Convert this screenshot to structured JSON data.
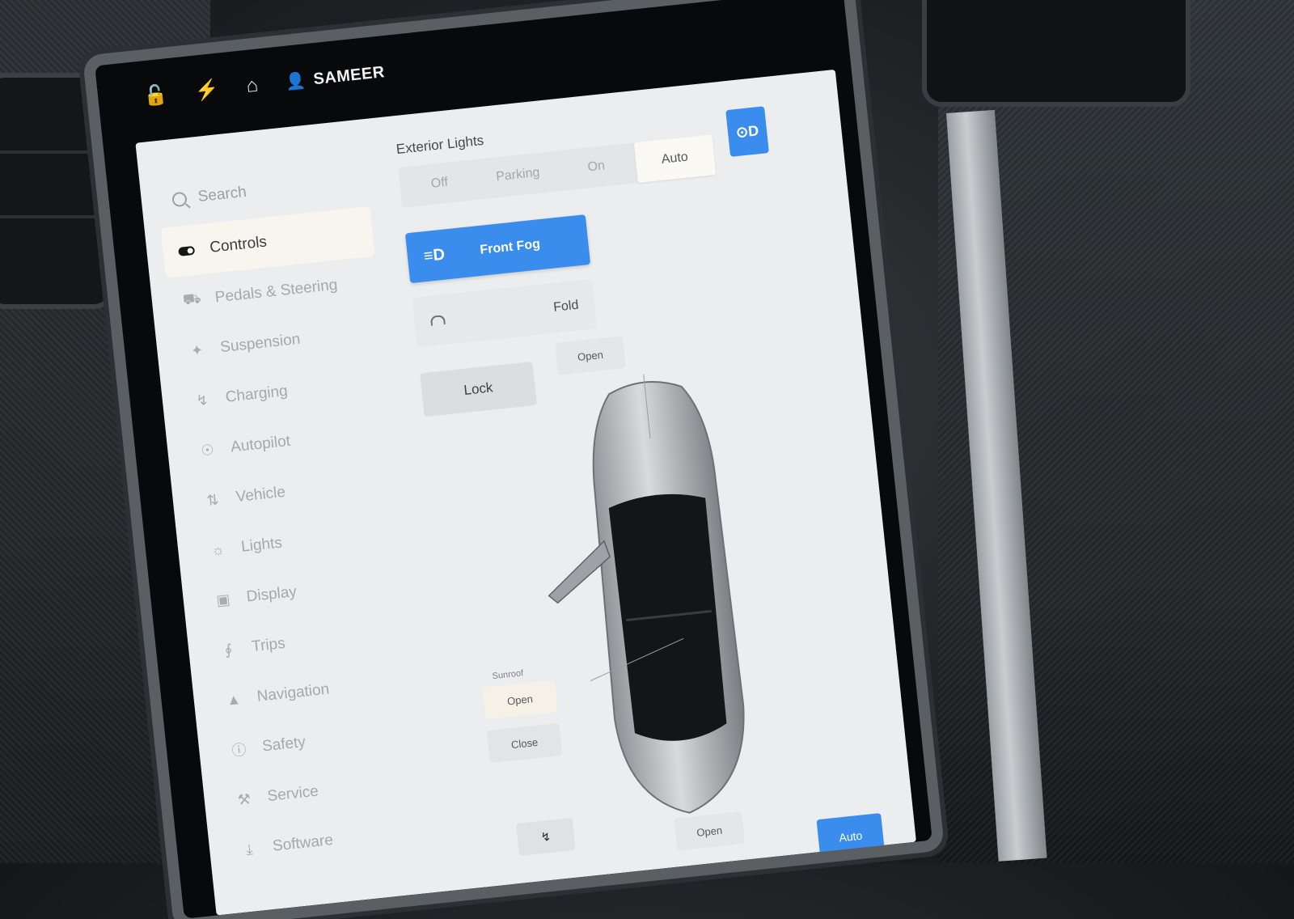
{
  "status_bar": {
    "icons": [
      "lock-open-icon",
      "bolt-icon",
      "home-icon",
      "user-icon"
    ],
    "user_name": "SAMEER"
  },
  "sidebar": {
    "search_placeholder": "Search",
    "items": [
      {
        "label": "Controls",
        "icon": "toggle-icon",
        "active": true
      },
      {
        "label": "Pedals & Steering",
        "icon": "car-icon"
      },
      {
        "label": "Suspension",
        "icon": "wrench-icon"
      },
      {
        "label": "Charging",
        "icon": "bolt-icon"
      },
      {
        "label": "Autopilot",
        "icon": "steering-wheel-icon"
      },
      {
        "label": "Vehicle",
        "icon": "sliders-icon"
      },
      {
        "label": "Lights",
        "icon": "sun-icon"
      },
      {
        "label": "Display",
        "icon": "display-icon"
      },
      {
        "label": "Trips",
        "icon": "trips-icon"
      },
      {
        "label": "Navigation",
        "icon": "navigation-arrow-icon"
      },
      {
        "label": "Safety",
        "icon": "info-circle-icon"
      },
      {
        "label": "Service",
        "icon": "wrench-icon"
      },
      {
        "label": "Software",
        "icon": "download-icon"
      }
    ]
  },
  "exterior_lights": {
    "title": "Exterior Lights",
    "options": [
      "Off",
      "Parking",
      "On",
      "Auto"
    ],
    "selected": "Auto"
  },
  "front_fog": {
    "label": "Front Fog",
    "active": true
  },
  "mirrors": {
    "label": "Fold"
  },
  "lock": {
    "label": "Lock"
  },
  "frunk": {
    "label": "Open"
  },
  "sunroof": {
    "title": "Sunroof",
    "open_label": "Open",
    "close_label": "Close"
  },
  "trunk": {
    "label": "Open"
  },
  "bottom": {
    "auto_label": "Auto"
  },
  "colors": {
    "accent": "#3b8ded",
    "panel": "#ecedef",
    "selected_segment": "#fbf9f4"
  }
}
